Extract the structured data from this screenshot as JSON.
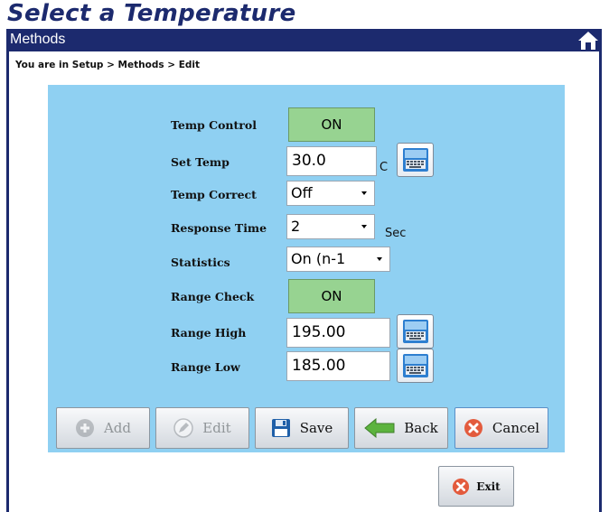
{
  "heading": "Select a Temperature",
  "window": {
    "title": "Methods",
    "home_icon": "home-icon"
  },
  "breadcrumb": "You are in  Setup > Methods > Edit",
  "form": {
    "temp_control": {
      "label": "Temp Control",
      "value": "ON"
    },
    "set_temp": {
      "label": "Set Temp",
      "value": "30.0",
      "unit": "C"
    },
    "temp_correct": {
      "label": "Temp Correct",
      "value": "Off"
    },
    "response_time": {
      "label": "Response Time",
      "value": "2",
      "unit": "Sec"
    },
    "statistics": {
      "label": "Statistics",
      "value": "On (n-1"
    },
    "range_check": {
      "label": "Range Check",
      "value": "ON"
    },
    "range_high": {
      "label": "Range High",
      "value": "195.00"
    },
    "range_low": {
      "label": "Range Low",
      "value": "185.00"
    }
  },
  "toolbar": {
    "add_label": "Add",
    "edit_label": "Edit",
    "save_label": "Save",
    "back_label": "Back",
    "cancel_label": "Cancel"
  },
  "exit_label": "Exit",
  "colors": {
    "navy": "#1c2a6e",
    "panel": "#8fd0f2",
    "toggle_on": "#97d391"
  }
}
